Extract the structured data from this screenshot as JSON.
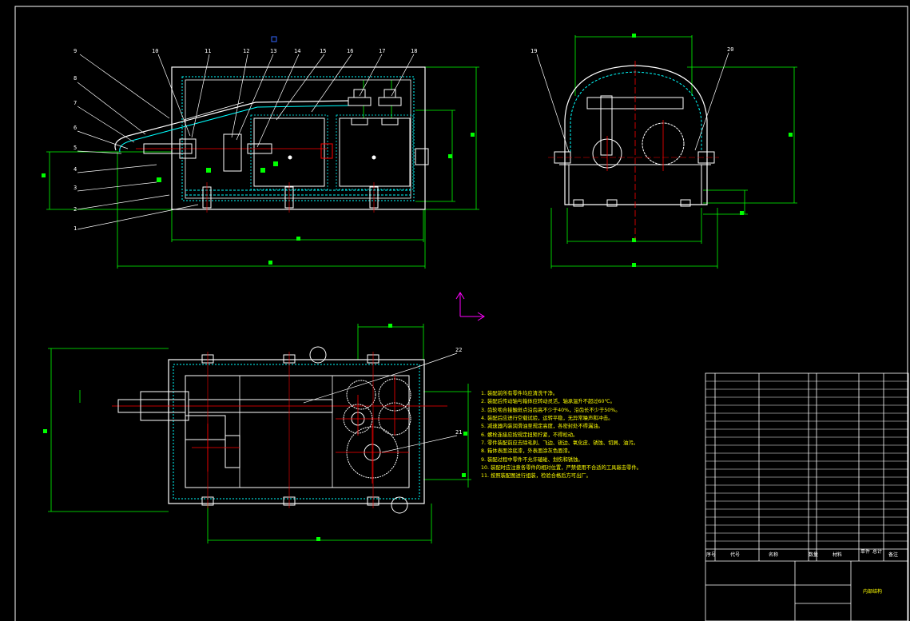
{
  "balloons": [
    "9",
    "10",
    "11",
    "12",
    "13",
    "14",
    "15",
    "16",
    "17",
    "18",
    "8",
    "7",
    "6",
    "5",
    "4",
    "3",
    "2",
    "1",
    "19",
    "20",
    "22",
    "21"
  ],
  "notes": [
    "1. 装配前所有零件均应清洗干净。",
    "2. 装配后传动轴与箱体应转动灵活，轴承温升不超过60℃。",
    "3. 齿轮啮合接触斑点沿齿高不少于40%，沿齿长不少于50%。",
    "4. 装配后应进行空载试验，运转平稳，无异常噪声和冲击。",
    "5. 减速器内装润滑油至规定高度，各密封处不得漏油。",
    "6. 螺栓连接应按规定扭矩拧紧，不得松动。",
    "7. 零件装配前应去除毛刺、飞边、锐边、氧化皮、锈蚀、切屑、油污。",
    "8. 箱体表面涂底漆，外表面涂灰色面漆。",
    "9. 装配过程中零件不允许磕碰、划伤和锈蚀。",
    "10. 装配时应注意各零件的相对位置，严禁使用不合适的工具敲击零件。",
    "11. 按照装配图进行组装，检验合格后方可出厂。"
  ],
  "title_block": {
    "headers": [
      "序号",
      "代号",
      "名称",
      "数量",
      "材料",
      "单件",
      "总计",
      "备注"
    ],
    "drawing_name": "内部结构"
  },
  "colors": {
    "background": "#000000",
    "outline": "#ffffff",
    "dimension": "#00ff00",
    "center": "#ff0000",
    "hatch": "#00ffff",
    "note": "#ffff00",
    "axis": "#ff00ff",
    "title": "#ffff00"
  }
}
